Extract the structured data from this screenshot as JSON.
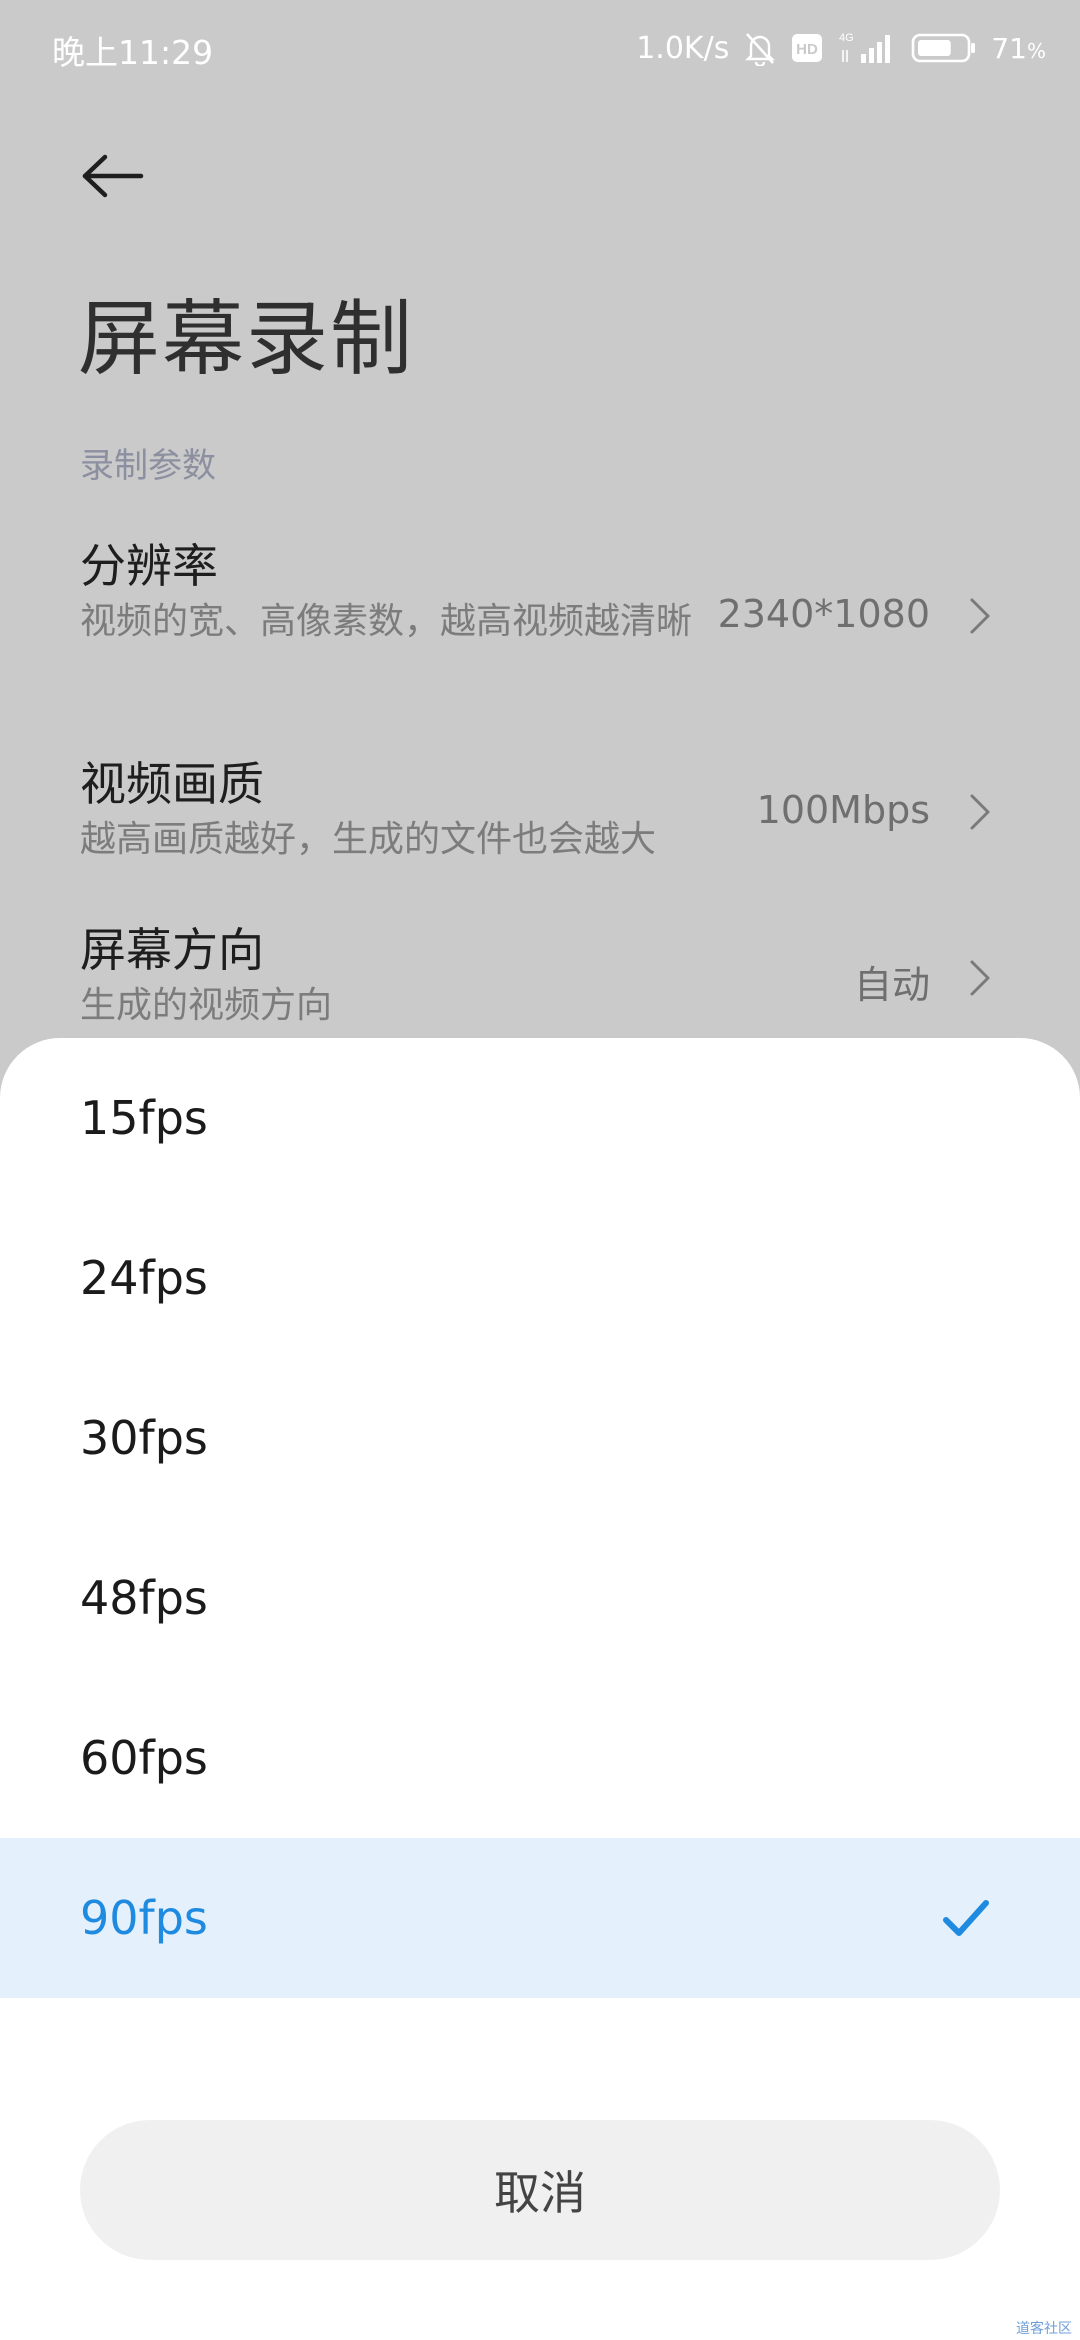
{
  "status_bar": {
    "time": "晚上11:29",
    "net_speed": "1.0K/s",
    "network_type": "4G",
    "hd_badge": "HD",
    "battery_percent": "71",
    "battery_unit": "%",
    "battery_level": 0.71
  },
  "page": {
    "title": "屏幕录制",
    "section_header": "录制参数",
    "settings": [
      {
        "title": "分辨率",
        "description": "视频的宽、高像素数，越高视频越清晰",
        "value": "2340*1080"
      },
      {
        "title": "视频画质",
        "description": "越高画质越好，生成的文件也会越大",
        "value": "100Mbps"
      },
      {
        "title": "屏幕方向",
        "description": "生成的视频方向",
        "value": "自动"
      }
    ]
  },
  "sheet": {
    "options": [
      "15fps",
      "24fps",
      "30fps",
      "48fps",
      "60fps",
      "90fps"
    ],
    "selected_index": 5,
    "cancel_label": "取消"
  },
  "watermark": "道客社区",
  "colors": {
    "accent": "#1f8be0",
    "selected_bg": "#e4f0fc",
    "scrim_bg": "#cacaca",
    "sheet_bg": "#ffffff"
  },
  "icons": {
    "back": "back-arrow-icon",
    "chevron": "chevron-right-icon",
    "check": "checkmark-icon",
    "mute": "bell-off-icon",
    "signal": "signal-bars-icon",
    "battery": "battery-icon"
  }
}
